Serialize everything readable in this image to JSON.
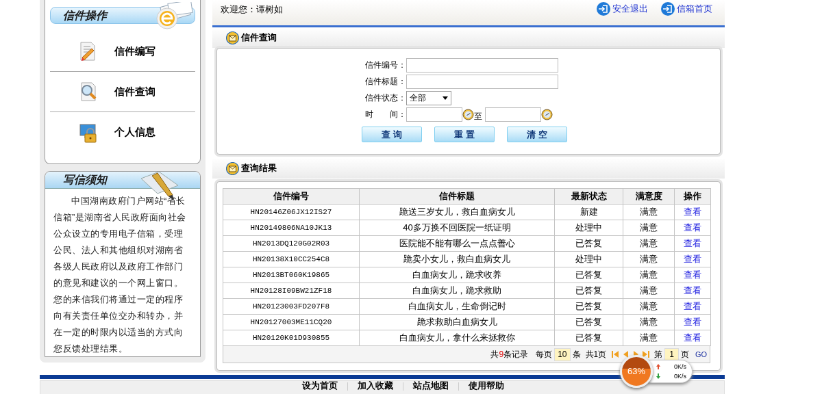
{
  "header": {
    "welcome": "欢迎您：谭树如",
    "links": [
      "安全退出",
      "信箱首页"
    ]
  },
  "sidebar": {
    "operations": {
      "title": "信件操作",
      "items": [
        {
          "kind": "compose",
          "label": "信件编写"
        },
        {
          "kind": "search",
          "label": "信件查询"
        },
        {
          "kind": "profile",
          "label": "个人信息"
        }
      ]
    },
    "notice": {
      "title": "写信须知",
      "text": "中国湖南政府门户网站“省长信箱”是湖南省人民政府面向社会公众设立的专用电子信箱，受理公民、法人和其他组织对湖南省各级人民政府以及政府工作部门的意见和建议的一个网上窗口。您的来信我们将通过一定的程序向有关责任单位交办和转办，并在一定的时限内以适当的方式向您反馈处理结果。"
    }
  },
  "query": {
    "title": "信件查询",
    "fields": [
      {
        "kind": "text",
        "label": "信件编号："
      },
      {
        "kind": "text",
        "label": "信件标题："
      },
      {
        "kind": "select",
        "label": "信件状态：",
        "value": "全部"
      },
      {
        "kind": "daterange",
        "label": "时　　间：",
        "separator": "至"
      }
    ],
    "buttons": [
      "查 询",
      "重 置",
      "清 空"
    ]
  },
  "results": {
    "title": "查询结果",
    "columns": [
      "信件编号",
      "信件标题",
      "最新状态",
      "满意度",
      "操作"
    ],
    "rows": [
      [
        "HN20146Z06JX12IS27",
        "跪送三岁女儿，救白血病女儿",
        "新建",
        "满意",
        "查看"
      ],
      [
        "HN20149806NA10JK13",
        "40多万换不回医院一纸证明",
        "处理中",
        "满意",
        "查看"
      ],
      [
        "HN2013DQ120G02R03",
        "医院能不能有哪么一点点善心",
        "已答复",
        "满意",
        "查看"
      ],
      [
        "HN20138X10CC254C8",
        "跪卖小女儿，救白血病女儿",
        "处理中",
        "满意",
        "查看"
      ],
      [
        "HN2013BT060K19865",
        "白血病女儿，跪求收养",
        "已答复",
        "满意",
        "查看"
      ],
      [
        "HN20128I09BW21ZF18",
        "白血病女儿，跪求救助",
        "已答复",
        "满意",
        "查看"
      ],
      [
        "HN20123003FD207F8",
        "白血病女儿，生命倒记时",
        "已答复",
        "满意",
        "查看"
      ],
      [
        "HN20127003ME11CQ20",
        "跪求救助白血病女儿",
        "已答复",
        "满意",
        "查看"
      ],
      [
        "HN20120K01D930855",
        "白血病女儿，拿什么来拯救你",
        "已答复",
        "满意",
        "查看"
      ]
    ],
    "pagination": {
      "total_before": "共",
      "total_count": "9",
      "total_after": "条记录",
      "per_page_label": "每页",
      "per_page": "10",
      "per_page_unit": "条",
      "pages": "共1页",
      "page_before": "第",
      "page": "1",
      "page_after": "页",
      "go": "GO"
    }
  },
  "footer_links": [
    "设为首页",
    "加入收藏",
    "站点地图",
    "使用帮助"
  ],
  "speed_widget": {
    "percent": "63%",
    "upload": "0K/s",
    "download": "0K/s"
  }
}
